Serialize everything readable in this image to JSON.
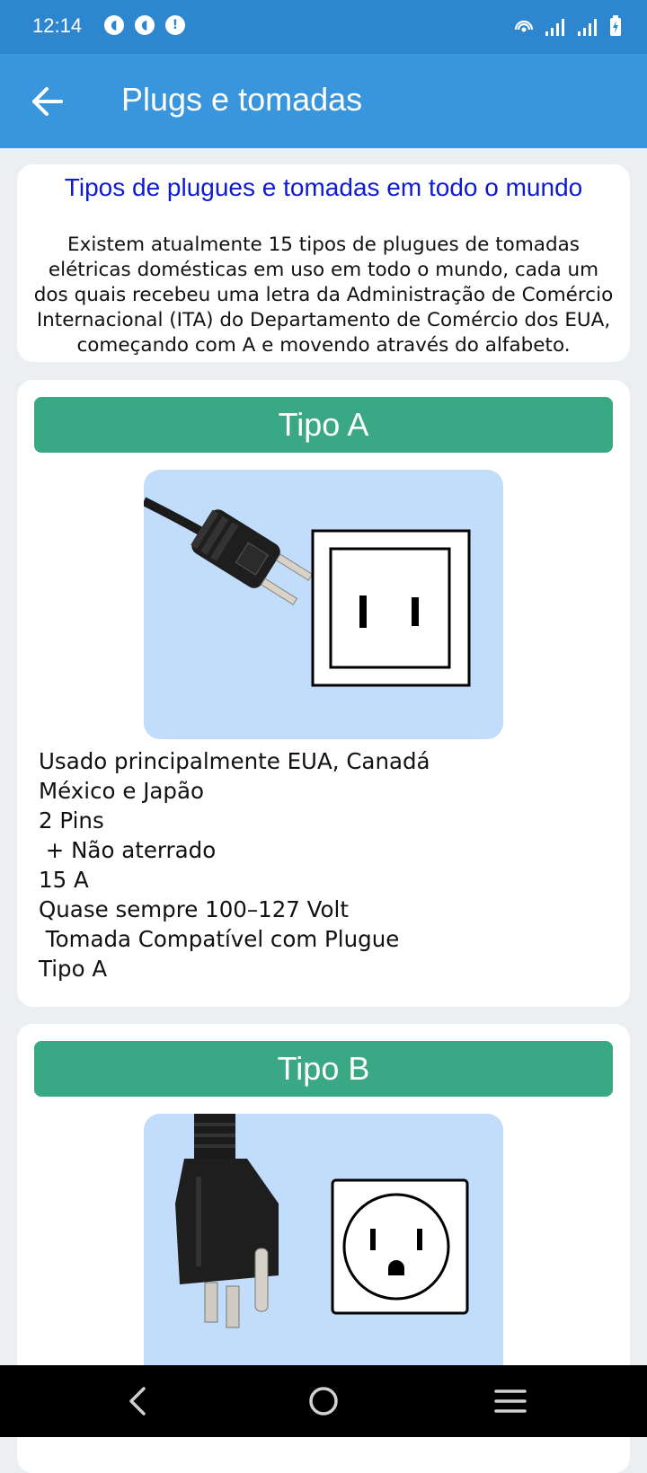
{
  "status_bar": {
    "time": "12:14",
    "left_icons": [
      "notification-app-icon",
      "notification-app-icon",
      "alert-icon"
    ],
    "right_icons": [
      "hotspot-icon",
      "signal-icon",
      "signal-icon",
      "battery-charging-icon"
    ]
  },
  "app_bar": {
    "title": "Plugs e tomadas",
    "back_icon": "arrow-left-icon"
  },
  "intro": {
    "title": "Tipos de plugues e tomadas em todo o mundo",
    "lines": [
      "Existem atualmente 15 tipos de plugues de tomadas",
      "elétricas domésticas em uso em todo o mundo, cada um",
      "dos quais recebeu uma letra da Administração de Comércio",
      "Internacional (ITA) do Departamento de Comércio dos EUA,",
      "começando com A e movendo através do alfabeto."
    ]
  },
  "types": [
    {
      "header": "Tipo A",
      "description": [
        "Usado principalmente EUA, Canadá",
        "México e Japão",
        "2 Pins",
        " + Não aterrado",
        "15 A",
        "Quase sempre 100–127 Volt",
        " Tomada Compatível com Plugue",
        "Tipo A"
      ]
    },
    {
      "header": "Tipo B",
      "description": []
    }
  ],
  "colors": {
    "status_bar": "#2e86cf",
    "app_bar": "#3a96dc",
    "intro_title": "#0f1bd0",
    "type_header": "#3aa884",
    "image_bg": "#c2ddfb"
  },
  "nav_bar": {
    "icons": [
      "nav-back-icon",
      "nav-home-icon",
      "nav-recents-icon"
    ]
  }
}
